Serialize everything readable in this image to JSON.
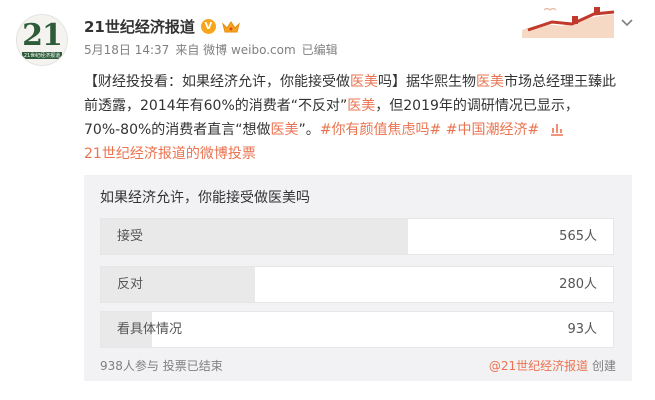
{
  "account": {
    "avatar_number": "21",
    "avatar_subtitle": "21世纪经济报道",
    "name": "21世纪经济报道",
    "verified_mark": "V",
    "icons": [
      "verified-icon",
      "crown-icon",
      "chevron-down-icon"
    ]
  },
  "meta": {
    "date": "5月18日 14:37",
    "source": "来自 微博 weibo.com",
    "edited": "已编辑"
  },
  "post": {
    "p1": "【财经投投看：如果经济允许，你能接受做",
    "hl1": "医美",
    "p2": "吗】据华熙生物",
    "hl2": "医美",
    "p3": "市场总经理王臻此前透露，2014年有60%的消费者“不反对”",
    "hl3": "医美",
    "p4": "，但2019年的调研情况已显示，70%-80%的消费者直言“想做",
    "hl4": "医美",
    "p5": "”。",
    "tag1": "#你有颜值焦虑吗#",
    "tag2": "#中国潮经济#",
    "link": "21世纪经济报道的微博投票"
  },
  "poll": {
    "question": "如果经济允许，你能接受做医美吗",
    "options": [
      {
        "label": "接受",
        "count": "565人",
        "fraction": 0.6
      },
      {
        "label": "反对",
        "count": "280人",
        "fraction": 0.3
      },
      {
        "label": "看具体情况",
        "count": "93人",
        "fraction": 0.1
      }
    ],
    "participants": "938人参与 投票已结束",
    "creator": "@21世纪经济报道",
    "created": "创建"
  },
  "colors": {
    "accent": "#eb7350",
    "brand_green": "#2e5b3a",
    "poll_bg": "#f2f2f5",
    "bar_fill": "#e9e9e9"
  }
}
